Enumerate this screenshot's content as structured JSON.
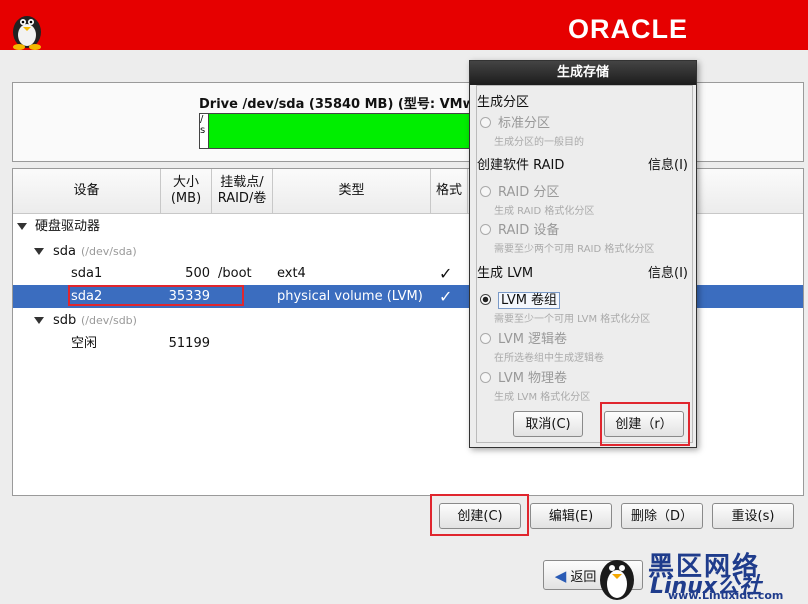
{
  "header": {
    "brand": "ORACLE"
  },
  "drive": {
    "title": "Drive /dev/sda (35840 MB) (型号: VMware",
    "seg1_label": "/\ns"
  },
  "table": {
    "columns": [
      "设备",
      "大小\n(MB)",
      "挂载点/\nRAID/卷",
      "类型",
      "格式"
    ],
    "hard_drives_label": "硬盘驱动器",
    "disks": [
      {
        "name": "sda",
        "path": "(/dev/sda)",
        "partitions": [
          {
            "name": "sda1",
            "size": "500",
            "mount": "/boot",
            "type": "ext4",
            "format": "✓"
          },
          {
            "name": "sda2",
            "size": "35339",
            "mount": "",
            "type": "physical volume (LVM)",
            "format": "✓"
          }
        ]
      },
      {
        "name": "sdb",
        "path": "(/dev/sdb)",
        "partitions": [
          {
            "name": "空闲",
            "size": "51199",
            "mount": "",
            "type": "",
            "format": ""
          }
        ]
      }
    ]
  },
  "buttons": {
    "create": "创建(C)",
    "edit": "编辑(E)",
    "delete": "删除（D）",
    "reset": "重设(s)",
    "back": "返回（B）"
  },
  "dialog": {
    "title": "生成存储",
    "section_partition": "生成分区",
    "opt_standard": "标准分区",
    "hint_standard": "生成分区的一般目的",
    "section_raid": "创建软件 RAID",
    "info_raid": "信息(I)",
    "opt_raid_partition": "RAID 分区",
    "hint_raid_partition": "生成 RAID 格式化分区",
    "opt_raid_device": "RAID 设备",
    "hint_raid_device": "需要至少两个可用 RAID 格式化分区",
    "section_lvm": "生成 LVM",
    "info_lvm": "信息(I)",
    "opt_lvm_vg": "LVM 卷组",
    "hint_lvm_vg": "需要至少一个可用 LVM 格式化分区",
    "opt_lvm_lv": "LVM 逻辑卷",
    "hint_lvm_lv": "在所选卷组中生成逻辑卷",
    "opt_lvm_pv": "LVM 物理卷",
    "hint_lvm_pv": "生成 LVM 格式化分区",
    "cancel": "取消(C)",
    "create": "创建（r）"
  },
  "watermark": {
    "cn": "黑区网络",
    "logo": "Linux公社",
    "url": "www.Linuxidc.com"
  },
  "colors": {
    "header_red": "#e60000",
    "selection_blue": "#3b6dbf",
    "bar_green": "#00ee00",
    "highlight_red": "#e0262e"
  }
}
